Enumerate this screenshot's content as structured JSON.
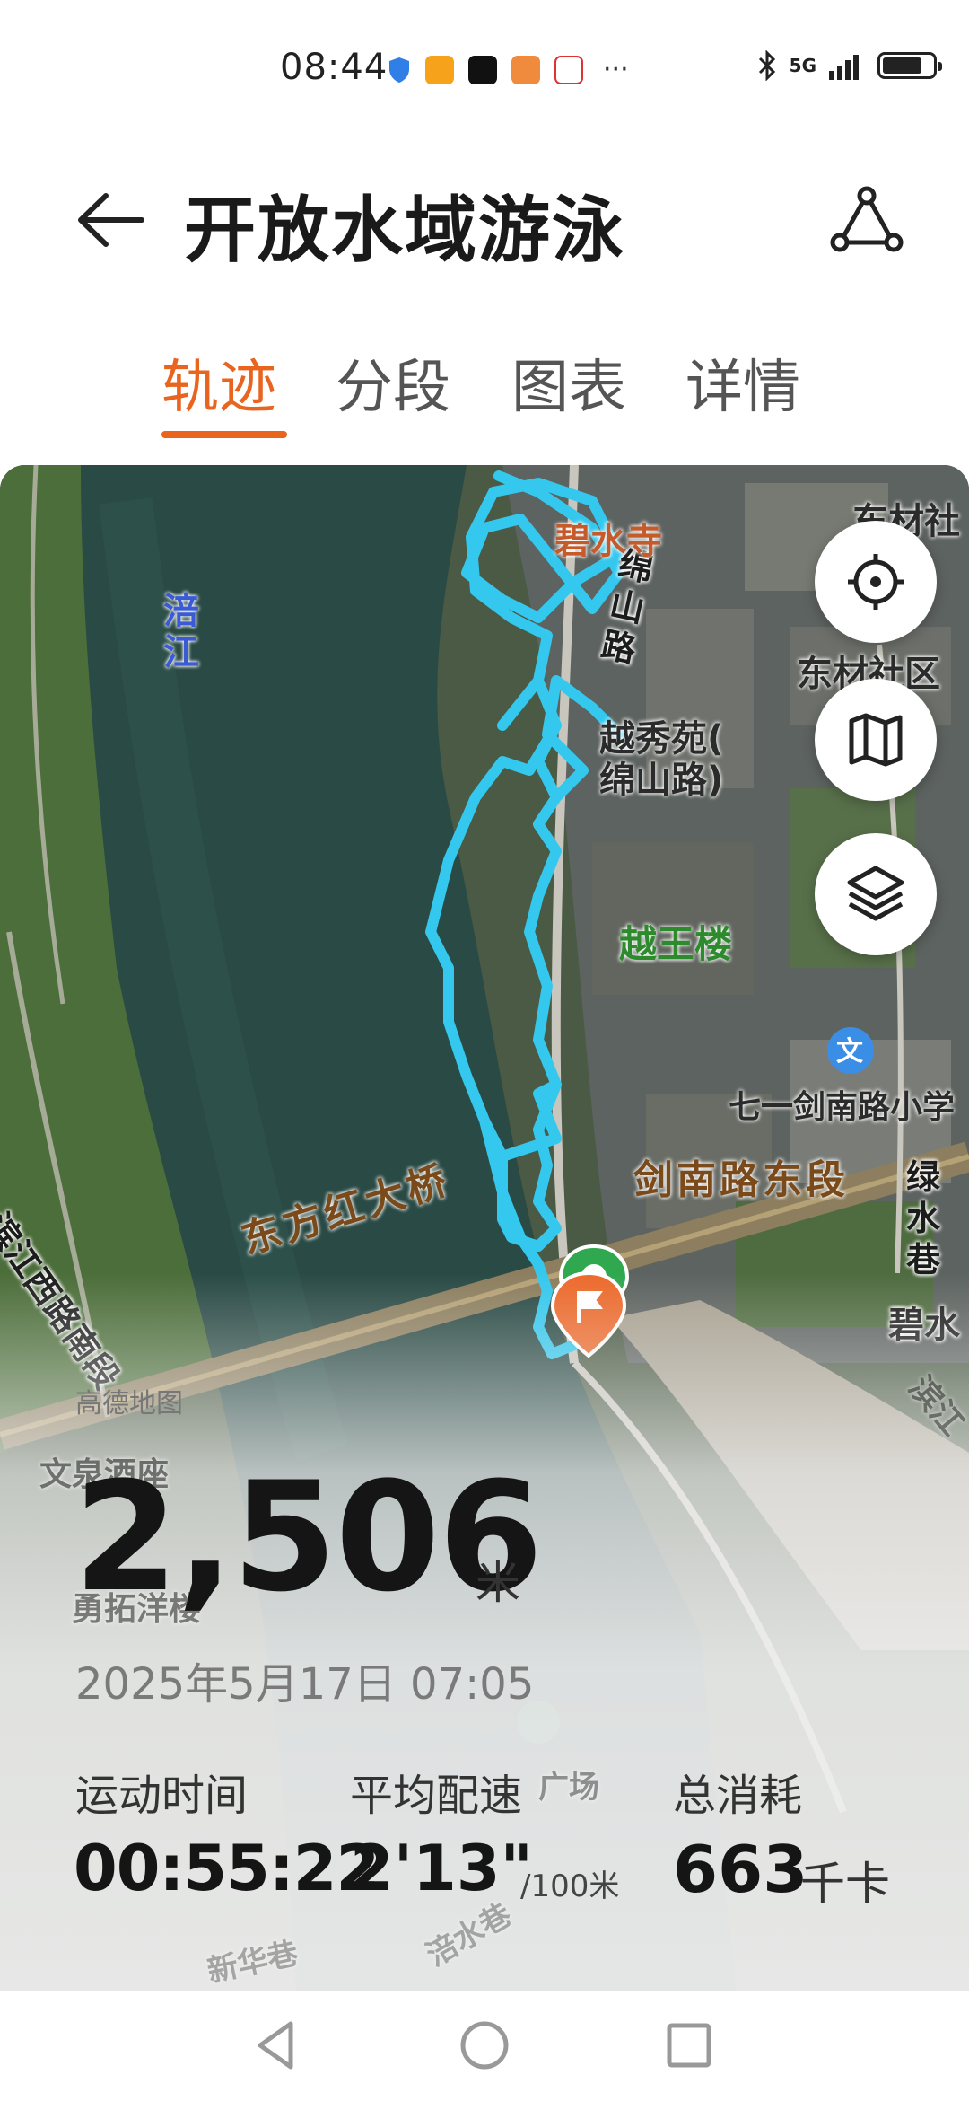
{
  "status_bar": {
    "time": "08:44",
    "network": "5G",
    "battery_level": 0.8
  },
  "header": {
    "title": "开放水域游泳",
    "back_icon": "arrow-left-icon",
    "share_icon": "route-share-icon"
  },
  "tabs": [
    {
      "label": "轨迹",
      "active": true
    },
    {
      "label": "分段",
      "active": false
    },
    {
      "label": "图表",
      "active": false
    },
    {
      "label": "详情",
      "active": false
    }
  ],
  "map": {
    "labels": {
      "river": "涪江",
      "bridge": "东方红大桥",
      "road_jiannan": "剑南路东段",
      "road_mianshan": "绵山路",
      "poi_bishui": "碧水寺",
      "poi_yuexiu": "越秀苑(\n绵山路)",
      "poi_yuewang": "越王楼",
      "poi_school": "七一剑南路小学",
      "poi_dongcai": "东材社",
      "poi_dongcai_community": "东材社区",
      "poi_lvshui": "绿水巷",
      "poi_bishui2": "碧水",
      "road_binjiang": "滨江西路南段",
      "poi_wenquan": "文泉酒座",
      "poi_yongtuo": "勇拓洋楼",
      "poi_guangchang": "广场",
      "poi_binjiang_e": "滨江",
      "poi_xinhua": "新华巷",
      "poi_fushui": "涪水巷",
      "poi_school_icon": "文",
      "credit": "高德地图"
    },
    "track_color": "#35c8ee",
    "buttons": [
      "locate-icon",
      "map-icon",
      "layers-icon"
    ]
  },
  "summary": {
    "distance": "2,506",
    "distance_unit": "米",
    "date": "2025年5月17日 07:05",
    "stats": [
      {
        "label": "运动时间",
        "value": "00:55:22",
        "unit": ""
      },
      {
        "label": "平均配速",
        "value": "2'13\"",
        "unit": "/100米"
      },
      {
        "label": "总消耗",
        "value": "663",
        "unit": "千卡"
      }
    ]
  },
  "nav": [
    "back-nav-icon",
    "home-nav-icon",
    "recents-nav-icon"
  ]
}
